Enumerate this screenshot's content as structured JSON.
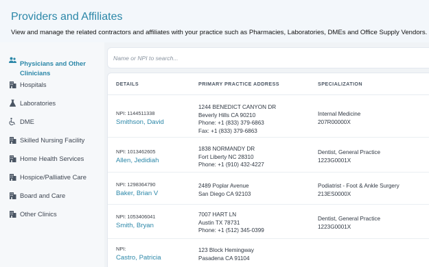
{
  "header": {
    "title": "Providers and Affiliates",
    "subtitle": "View and manage the related contractors and affiliates with your practice such as Pharmacies, Laboratories, DMEs and Office Supply Vendors."
  },
  "sidebar": {
    "items": [
      {
        "label": "Physicians and Other Clinicians",
        "icon": "people-icon",
        "active": true
      },
      {
        "label": "Hospitals",
        "icon": "building-icon"
      },
      {
        "label": "Laboratories",
        "icon": "flask-icon"
      },
      {
        "label": "DME",
        "icon": "wheelchair-icon"
      },
      {
        "label": "Skilled Nursing Facility",
        "icon": "building-icon"
      },
      {
        "label": "Home Health Services",
        "icon": "building-icon"
      },
      {
        "label": "Hospice/Palliative Care",
        "icon": "building-icon"
      },
      {
        "label": "Board and Care",
        "icon": "building-icon"
      },
      {
        "label": "Other Clinics",
        "icon": "building-icon"
      }
    ]
  },
  "search": {
    "placeholder": "Name or NPI to search..."
  },
  "table": {
    "columns": [
      "DETAILS",
      "PRIMARY PRACTICE ADDRESS",
      "SPECIALIZATION"
    ],
    "rows": [
      {
        "npi": "NPI: 1144511338",
        "name": "Smithson, David",
        "address": [
          "1244 BENEDICT CANYON DR",
          "Beverly Hills CA 90210",
          "Phone: +1 (833) 379-6863",
          "Fax: +1 (833) 379-6863"
        ],
        "specialization": [
          "Internal Medicine",
          "207R00000X"
        ]
      },
      {
        "npi": "NPI: 1013462605",
        "name": "Allen, Jedidiah",
        "address": [
          "1838 NORMANDY DR",
          "Fort Liberty NC 28310",
          "Phone: +1 (910) 432-4227"
        ],
        "specialization": [
          "Dentist, General Practice",
          "1223G0001X"
        ]
      },
      {
        "npi": "NPI: 1298364790",
        "name": "Baker, Brian V",
        "address": [
          "2489 Poplar Avenue",
          "San Diego CA 92103"
        ],
        "specialization": [
          "Podiatrist - Foot & Ankle Surgery",
          "213ES0000X"
        ]
      },
      {
        "npi": "NPI: 1053406041",
        "name": "Smith, Bryan",
        "address": [
          "7007 HART LN",
          "Austin TX 78731",
          "Phone: +1 (512) 345-0399"
        ],
        "specialization": [
          "Dentist, General Practice",
          "1223G0001X"
        ]
      },
      {
        "npi": "NPI:",
        "name": "Castro, Patricia",
        "address": [
          "123 Block Hemingway",
          "Pasadena CA 91104"
        ],
        "specialization": []
      }
    ]
  },
  "colors": {
    "accent": "#2b87a8",
    "header_bg": "#f3f7fb",
    "sidebar_bg": "#f6f8fa"
  }
}
